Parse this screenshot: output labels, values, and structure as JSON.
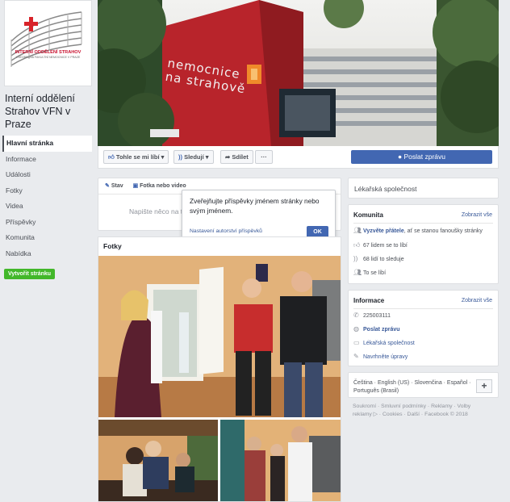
{
  "logo": {
    "line1": "INTERNÍ ODDĚLENÍ STRAHOV",
    "line2": "VŠEOBECNÁ FAKULTNÍ NEMOCNICE V PRAZE"
  },
  "page_name": "Interní oddělení Strahov VFN v Praze",
  "nav": [
    "Hlavní stránka",
    "Informace",
    "Události",
    "Fotky",
    "Videa",
    "Příspěvky",
    "Komunita",
    "Nabídka"
  ],
  "create_page": "Vytvořit stránku",
  "cover": {
    "sign": [
      "nemocnice",
      "na strahově"
    ]
  },
  "actions": {
    "like": "Tohle se mi líbí",
    "follow": "Sledují",
    "share": "Sdílet",
    "more": "···",
    "send_message": "Poslat zprávu"
  },
  "composer": {
    "tab_status": "Stav",
    "tab_photo": "Fotka nebo video",
    "placeholder": "Napište něco na tu stránku..."
  },
  "tooltip": {
    "text": "Zveřejňujte příspěvky jménem stránky nebo svým jménem.",
    "link": "Nastavení autorství příspěvků",
    "ok": "OK"
  },
  "photos": {
    "title": "Fotky"
  },
  "category": "Lékařská společnost",
  "community": {
    "title": "Komunita",
    "show_all": "Zobrazit vše",
    "invite": "Vyzvěte přátele",
    "invite_rest": ", ať se stanou fanoušky stránky",
    "likes": "67 lidem se to líbí",
    "followers": "68 lidí to sleduje",
    "liked_by": "To se líbí"
  },
  "info": {
    "title": "Informace",
    "show_all": "Zobrazit vše",
    "phone": "225003111",
    "message": "Poslat zprávu",
    "category": "Lékařská společnost",
    "suggest": "Navrhněte úpravy"
  },
  "languages": {
    "list": "Čeština · English (US) · Slovenčina · Español · Português (Brasil)",
    "plus": "+"
  },
  "footer": "Soukromí · Smluvní podmínky · Reklamy · Volby reklamy ▷ · Cookies · Další · Facebook © 2018"
}
